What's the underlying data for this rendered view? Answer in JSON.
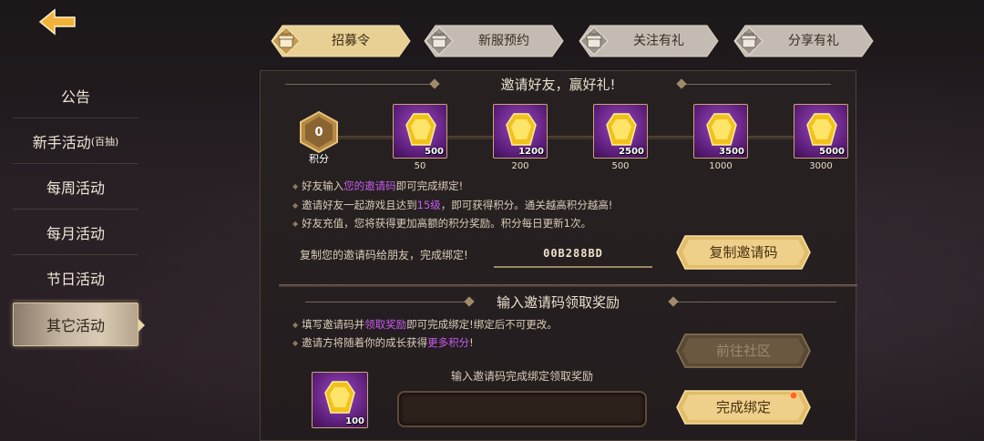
{
  "sidebar": {
    "items": [
      {
        "label": "公告",
        "sub": ""
      },
      {
        "label": "新手活动",
        "sub": "(百抽)"
      },
      {
        "label": "每周活动",
        "sub": ""
      },
      {
        "label": "每月活动",
        "sub": ""
      },
      {
        "label": "节日活动",
        "sub": ""
      },
      {
        "label": "其它活动",
        "sub": "",
        "active": true
      }
    ]
  },
  "tabs": [
    {
      "label": "招募令",
      "active": true
    },
    {
      "label": "新服预约"
    },
    {
      "label": "关注有礼"
    },
    {
      "label": "分享有礼"
    }
  ],
  "invite": {
    "title": "邀请好友，赢好礼!",
    "score_value": "0",
    "score_unit": "积分",
    "rewards": [
      {
        "count": "500",
        "need": "50"
      },
      {
        "count": "1200",
        "need": "200"
      },
      {
        "count": "2500",
        "need": "500"
      },
      {
        "count": "3500",
        "need": "1000"
      },
      {
        "count": "5000",
        "need": "3000"
      }
    ],
    "rule1": {
      "a": "好友输入",
      "b": "您的邀请码",
      "c": "即可完成绑定!"
    },
    "rule2": {
      "a": "邀请好友一起游戏且达到",
      "b": "15级",
      "c": "，即可获得积分。通关越高积分越高!"
    },
    "rule3": "好友充值，您将获得更加高额的积分奖励。积分每日更新1次。",
    "copy_hint": "复制您的邀请码给朋友，完成绑定!",
    "code": "00B288BD",
    "copy_button": "复制邀请码"
  },
  "redeem": {
    "title": "输入邀请码领取奖励",
    "rule1": {
      "a": "填写邀请码并",
      "b": "领取奖励",
      "c": "即可完成绑定!绑定后不可更改。"
    },
    "rule2": {
      "a": "邀请方将随着你的成长获得",
      "b": "更多积分",
      "c": "!"
    },
    "community_button": "前往社区",
    "input_label": "输入邀请码完成绑定领取奖励",
    "reward_count": "100",
    "bind_button": "完成绑定"
  },
  "colors": {
    "gold": "#e7c77a",
    "purple_text": "#c75cf0",
    "reward_bg": "#6b2490"
  }
}
